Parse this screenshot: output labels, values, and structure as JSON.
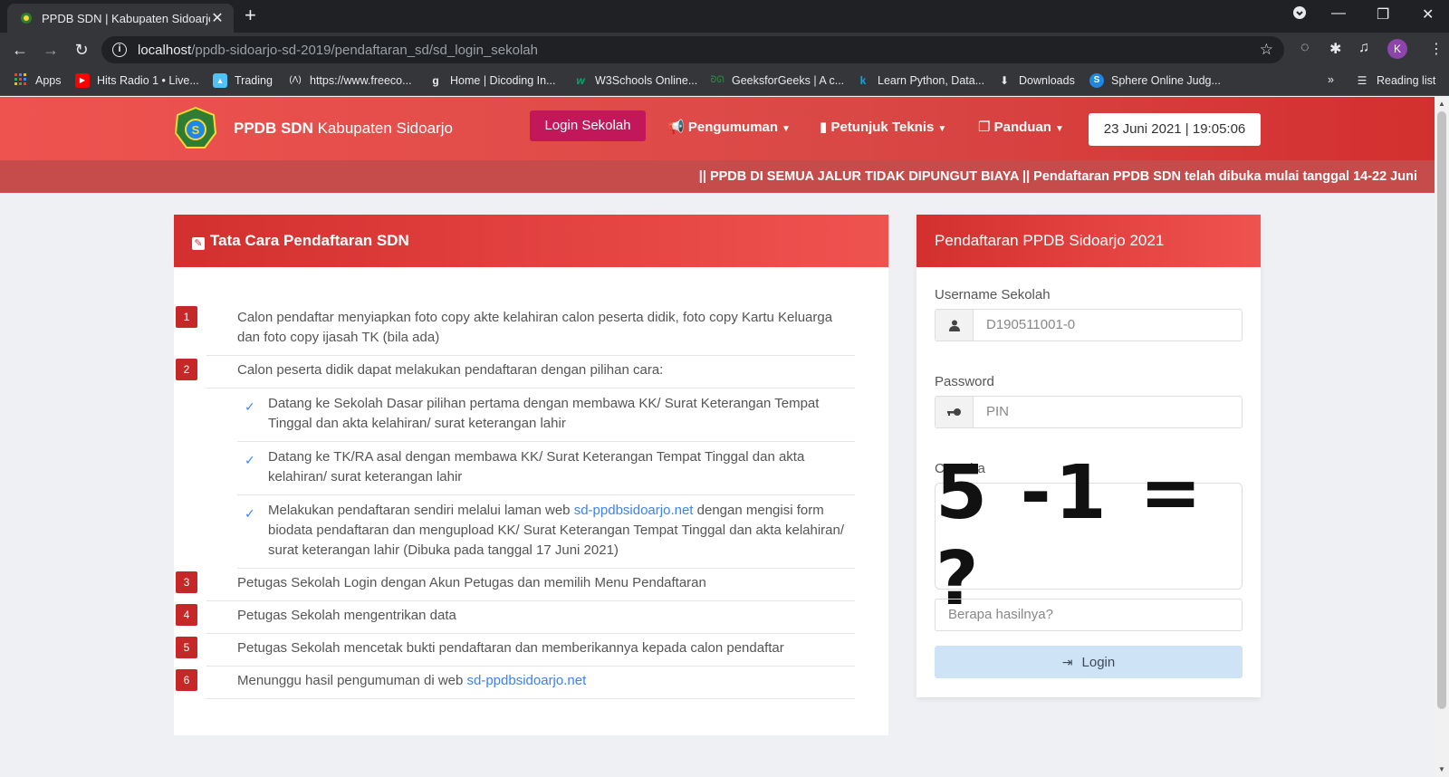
{
  "browser": {
    "tab_title": "PPDB SDN | Kabupaten Sidoarjo",
    "url_host": "localhost",
    "url_path": "/ppdb-sidoarjo-sd-2019/pendaftaran_sd/sd_login_sekolah",
    "profile_initial": "K",
    "bookmarks": [
      {
        "label": "Apps",
        "icon": "apps-grid-icon",
        "color": "#e8eaed"
      },
      {
        "label": "Hits Radio 1 • Live...",
        "icon": "youtube-icon",
        "color": "#ff0000"
      },
      {
        "label": "Trading",
        "icon": "image-icon",
        "color": "#4fc3f7"
      },
      {
        "label": "https://www.freeco...",
        "icon": "freecodecamp-icon",
        "color": "#e8eaed"
      },
      {
        "label": "Home | Dicoding In...",
        "icon": "dicoding-icon",
        "color": "#e8eaed"
      },
      {
        "label": "W3Schools Online...",
        "icon": "w3schools-icon",
        "color": "#04aa6d"
      },
      {
        "label": "GeeksforGeeks | A c...",
        "icon": "geeksforgeeks-icon",
        "color": "#2f8d46"
      },
      {
        "label": "Learn Python, Data...",
        "icon": "datacamp-icon",
        "color": "#03a9f4"
      },
      {
        "label": "Downloads",
        "icon": "download-icon",
        "color": "#e8eaed"
      },
      {
        "label": "Sphere Online Judg...",
        "icon": "spoj-icon",
        "color": "#1e88e5"
      }
    ],
    "more_label": "»",
    "reading_list": "Reading list"
  },
  "nav": {
    "brand_bold": "PPDB SDN",
    "brand_rest": "Kabupaten Sidoarjo",
    "login": "Login Sekolah",
    "pengumuman": "Pengumuman",
    "petunjuk": "Petunjuk Teknis",
    "panduan": "Panduan",
    "datetime": "23 Juni 2021 | 19:05:06"
  },
  "marquee": "|| PPDB DI SEMUA JALUR TIDAK DIPUNGUT BIAYA || Pendaftaran PPDB SDN telah dibuka mulai tanggal 14-22 Juni",
  "tata_cara": {
    "title": "Tata Cara Pendaftaran SDN",
    "steps": [
      {
        "num": "1",
        "text": "Calon pendaftar menyiapkan foto copy akte kelahiran calon peserta didik, foto copy Kartu Keluarga dan foto copy ijasah TK (bila ada)"
      },
      {
        "num": "2",
        "text": "Calon peserta didik dapat melakukan pendaftaran dengan pilihan cara:"
      },
      {
        "num": "3",
        "text": "Petugas Sekolah Login dengan Akun Petugas dan memilih Menu Pendaftaran"
      },
      {
        "num": "4",
        "text": "Petugas Sekolah mengentrikan data"
      },
      {
        "num": "5",
        "text": "Petugas Sekolah mencetak bukti pendaftaran dan memberikannya kepada calon pendaftar"
      },
      {
        "num": "6",
        "text_before": "Menunggu hasil pengumuman di web ",
        "link": "sd-ppdbsidoarjo.net"
      }
    ],
    "substeps": [
      {
        "text": "Datang ke Sekolah Dasar pilihan pertama dengan membawa KK/ Surat Keterangan Tempat Tinggal dan akta kelahiran/ surat keterangan lahir"
      },
      {
        "text": "Datang ke TK/RA asal dengan membawa KK/ Surat Keterangan Tempat Tinggal dan akta kelahiran/ surat keterangan lahir"
      },
      {
        "text_before": "Melakukan pendaftaran sendiri melalui laman web ",
        "link": "sd-ppdbsidoarjo.net",
        "text_after": " dengan mengisi form biodata pendaftaran dan mengupload KK/ Surat Keterangan Tempat Tinggal dan akta kelahiran/ surat keterangan lahir (Dibuka pada tanggal 17 Juni 2021)"
      }
    ]
  },
  "login_form": {
    "title": "Pendaftaran PPDB Sidoarjo 2021",
    "username_label": "Username Sekolah",
    "username_value": "D190511001-0",
    "password_label": "Password",
    "password_placeholder": "PIN",
    "captcha_label": "Captcha",
    "captcha_text": "5 -1 = ?",
    "captcha_placeholder": "Berapa hasilnya?",
    "login_button": "Login"
  },
  "colors": {
    "header_red": "#d94845",
    "login_pink": "#c2185b",
    "step_badge": "#c62828",
    "link_blue": "#3b82f6",
    "login_button_bg": "#cfe3f6"
  }
}
